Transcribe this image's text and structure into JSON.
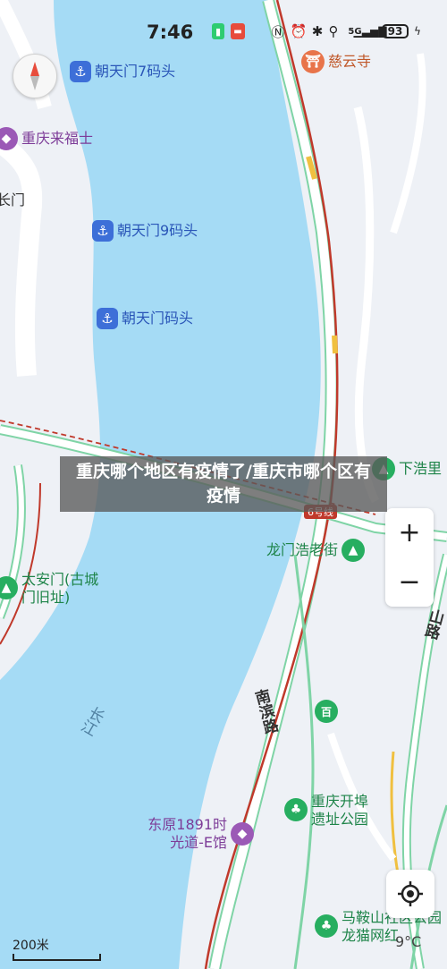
{
  "status_bar": {
    "time": "7:46",
    "network": "5G",
    "battery": "93"
  },
  "pois": {
    "ciyun_temple": "慈云寺",
    "chaotianmen_7": "朝天门7码头",
    "laifushi": "重庆来福士",
    "men_partial": "长门",
    "chaotianmen_9": "朝天门9码头",
    "chaotianmen": "朝天门码头",
    "xiahaoli": "下浩里",
    "longmen_street": "龙门浩老街",
    "taian_gate": "太安门(古城门旧址)",
    "kaibu_park": "重庆开埠遗址公园",
    "dongyuan": "东原1891时光道-E馆",
    "maanshan": "马鞍山社区公园龙猫网红",
    "hundred": "百"
  },
  "road_labels": {
    "nanbin_road": "南滨路",
    "river": "长江",
    "line_6": "6号线",
    "right_road": "山路"
  },
  "overlay": {
    "title": "重庆哪个地区有疫情了/重庆市哪个区有疫情"
  },
  "controls": {
    "zoom_in": "+",
    "zoom_out": "−"
  },
  "scale": {
    "label": "200米"
  },
  "weather": {
    "temp": "9°C"
  },
  "colors": {
    "river": "#a5dbf5",
    "land": "#eef1f6",
    "road_outline": "#7fd4a6",
    "rail": "#c0392b",
    "poi_purple": "#9b59b6",
    "poi_green": "#27ae60",
    "poi_blue": "#3d6fd8",
    "poi_orange": "#e8744a"
  }
}
